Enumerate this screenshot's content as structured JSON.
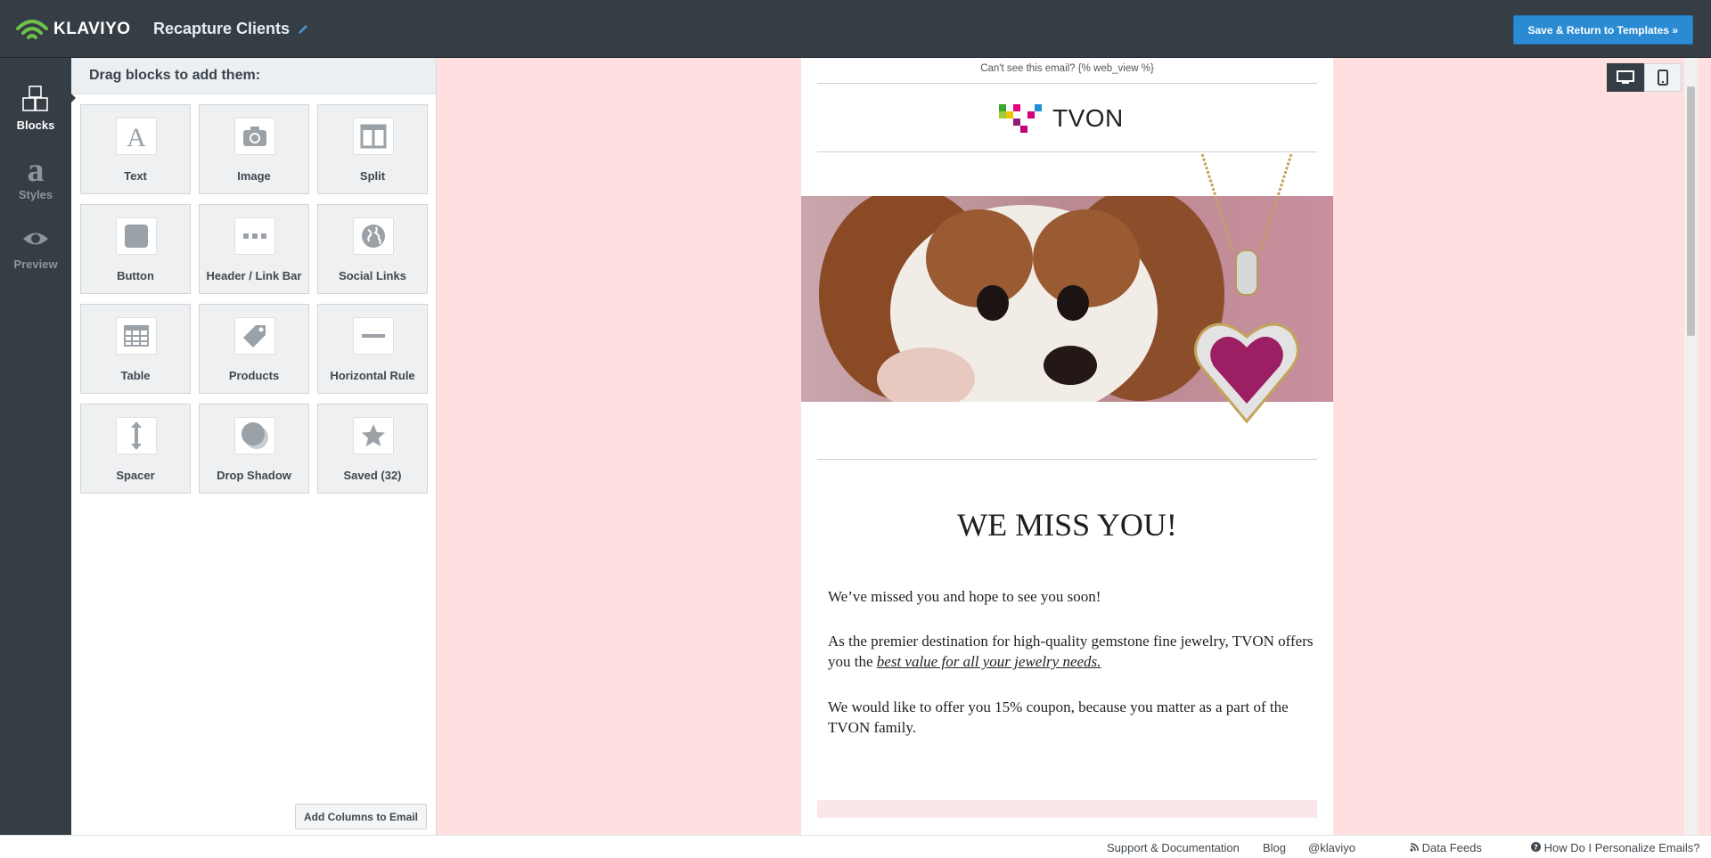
{
  "app": {
    "brand": "KLAVIYO",
    "campaign_title": "Recapture Clients",
    "save_button": "Save & Return to Templates »"
  },
  "rail": {
    "items": [
      {
        "label": "Blocks",
        "icon": "blocks-icon",
        "active": true
      },
      {
        "label": "Styles",
        "icon": "styles-icon",
        "active": false
      },
      {
        "label": "Preview",
        "icon": "eye-icon",
        "active": false
      }
    ]
  },
  "panel": {
    "header": "Drag blocks to add them:",
    "blocks": [
      {
        "label": "Text",
        "icon": "text-icon"
      },
      {
        "label": "Image",
        "icon": "camera-icon"
      },
      {
        "label": "Split",
        "icon": "split-icon"
      },
      {
        "label": "Button",
        "icon": "button-icon"
      },
      {
        "label": "Header / Link Bar",
        "icon": "dots-icon"
      },
      {
        "label": "Social Links",
        "icon": "globe-icon"
      },
      {
        "label": "Table",
        "icon": "table-icon"
      },
      {
        "label": "Products",
        "icon": "tag-icon"
      },
      {
        "label": "Horizontal Rule",
        "icon": "rule-icon"
      },
      {
        "label": "Spacer",
        "icon": "spacer-icon"
      },
      {
        "label": "Drop Shadow",
        "icon": "shadow-icon"
      },
      {
        "label": "Saved (32)",
        "icon": "star-icon"
      }
    ],
    "add_columns": "Add Columns to Email"
  },
  "email": {
    "webview": "Can't see this email? {% web_view %}",
    "brand": "TVON",
    "headline": "WE MISS YOU!",
    "p1": "We’ve missed you and hope to see you soon!",
    "p2_text": "As the premier destination for high-quality gemstone fine jewelry, TVON offers you the ",
    "p2_link": "best value for all your jewelry needs.",
    "p3": "We would like to offer you 15% coupon, because you matter as a part of the TVON family."
  },
  "footer": {
    "links": [
      "Support & Documentation",
      "Blog",
      "@klaviyo",
      "Data Feeds",
      "How Do I Personalize Emails?"
    ]
  },
  "colors": {
    "topbar": "#353d45",
    "accent": "#2a8bd3",
    "canvas_bg": "#ffdfe0",
    "brand_green": "#6cc24a"
  }
}
